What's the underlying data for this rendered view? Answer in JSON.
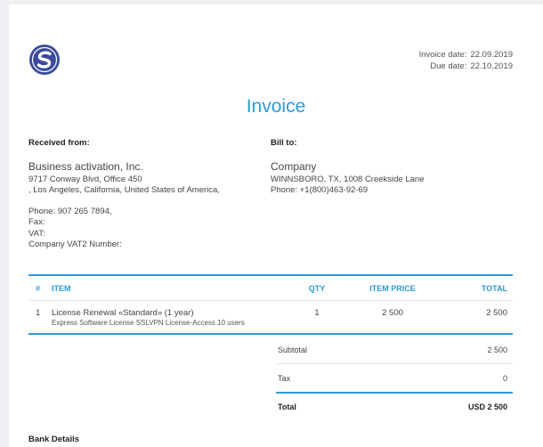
{
  "invoice": {
    "date_label": "Invoice date:",
    "date_value": "22.09.2019",
    "due_label": "Due date:",
    "due_value": "22.10.2019",
    "title": "Invoice"
  },
  "logo": {
    "icon": "s-logo-icon",
    "color": "#3b4a9c"
  },
  "received": {
    "heading": "Received from:",
    "name": "Business activation, Inc.",
    "address1": "9717 Conway Blvd, Office 450",
    "address2": ", Los Angeles, California, United States of America,",
    "phone": "Phone: 907 265 7894,",
    "fax": "Fax:",
    "vat": "VAT:",
    "vat2": "Company VAT2 Number:"
  },
  "bill": {
    "heading": "Bill to:",
    "name": "Company",
    "address": "WINNSBORO, TX, 1008 Creekside Lane",
    "phone": "Phone: +1(800)463-92-69"
  },
  "table": {
    "headers": {
      "num": "#",
      "item": "ITEM",
      "qty": "QTY",
      "price": "ITEM PRICE",
      "total": "TOTAL"
    },
    "rows": [
      {
        "num": "1",
        "item": "License Renewal «Standard» (1 year)",
        "description": "Express Software License SSLVPN License-Access 10 users",
        "qty": "1",
        "price": "2 500",
        "total": "2 500"
      }
    ]
  },
  "summary": {
    "subtotal_label": "Subtotal",
    "subtotal_value": "2 500",
    "tax_label": "Tax",
    "tax_value": "0",
    "total_label": "Total",
    "total_value": "USD 2 500"
  },
  "bank": {
    "heading": "Bank Details"
  },
  "colors": {
    "accent": "#2b9bd8",
    "background": "#eef0f3"
  }
}
